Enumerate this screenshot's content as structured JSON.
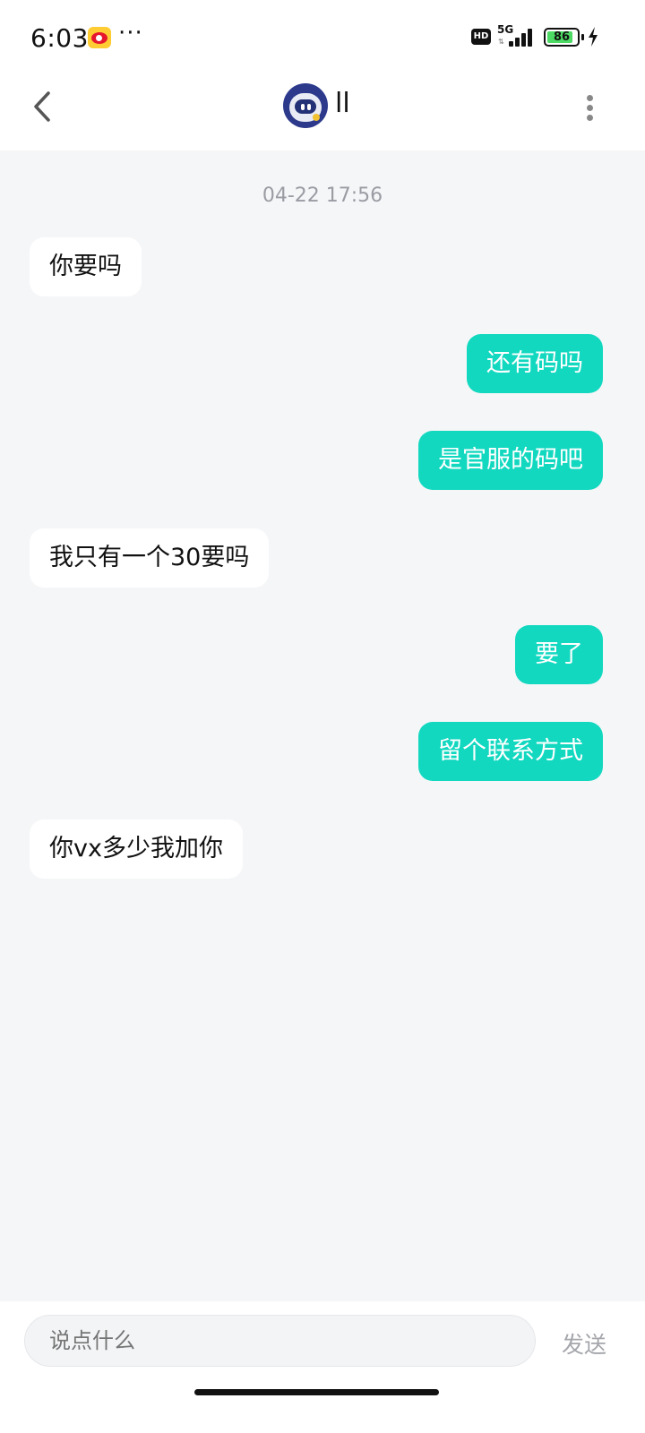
{
  "status_bar": {
    "time": "6:03",
    "more": "···",
    "hd": "HD",
    "network": "5G",
    "battery_percent": "86",
    "battery_level": 0.86,
    "icons": [
      "weibo-icon",
      "hd-icon",
      "signal-icon",
      "battery-icon",
      "charging-icon"
    ]
  },
  "header": {
    "contact_name": "ll",
    "back_icon": "chevron-left-icon",
    "more_icon": "vertical-dots-icon"
  },
  "chat": {
    "timestamp": "04-22 17:56",
    "messages": [
      {
        "side": "in",
        "text": "你要吗"
      },
      {
        "side": "out",
        "text": "还有码吗"
      },
      {
        "side": "out",
        "text": "是官服的码吧"
      },
      {
        "side": "in",
        "text": "我只有一个30要吗"
      },
      {
        "side": "out",
        "text": "要了"
      },
      {
        "side": "out",
        "text": "留个联系方式"
      },
      {
        "side": "in",
        "text": "你vx多少我加你"
      }
    ]
  },
  "input_bar": {
    "placeholder": "说点什么",
    "send_label": "发送"
  },
  "colors": {
    "outgoing_bubble": "#12d8c0",
    "incoming_bubble": "#ffffff",
    "chat_background": "#f5f6f8"
  }
}
